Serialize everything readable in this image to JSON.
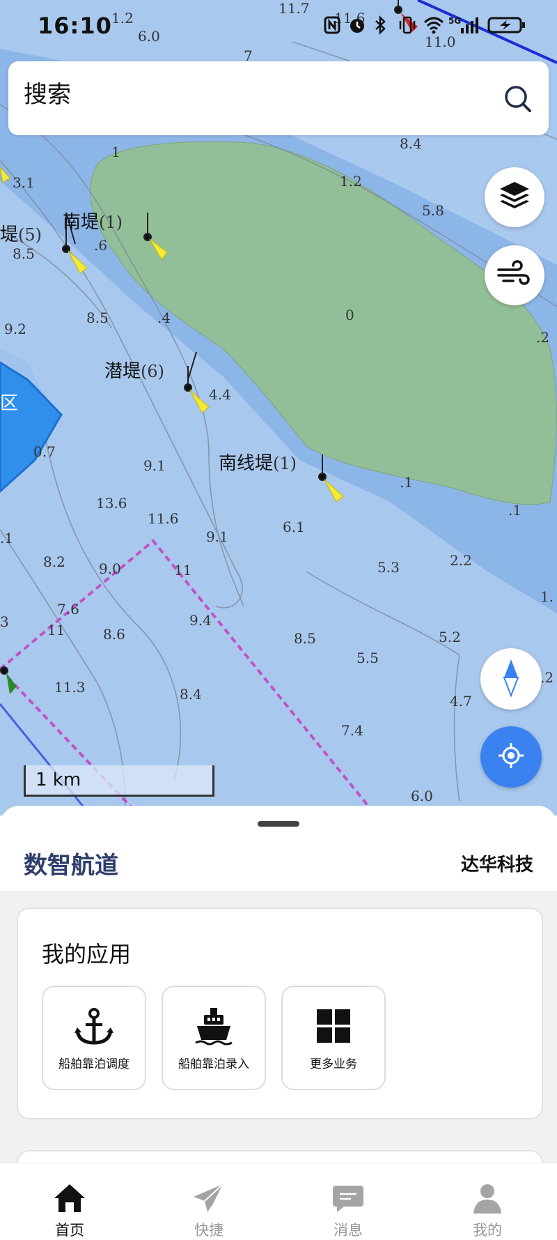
{
  "status_bar": {
    "time": "16:10",
    "network": "5G"
  },
  "search": {
    "placeholder": "搜索",
    "icon": "search-icon"
  },
  "map": {
    "labels": [
      {
        "name": "南堤",
        "num": "(1)"
      },
      {
        "name": "堤",
        "num": "(5)"
      },
      {
        "name": "潜堤",
        "num": "(6)"
      },
      {
        "name": "南线堤",
        "num": "(1)"
      }
    ],
    "zone_label": "区",
    "depths": [
      "11.7",
      "1.2",
      "6.0",
      "7",
      "11.6",
      "11.0",
      "8.4",
      "1",
      "3.1",
      "1.2",
      "5.8",
      "8.5",
      ".6",
      "8.5",
      ".4",
      "0",
      "9.2",
      ".2",
      "4.4",
      "0.7",
      "9.1",
      ".1",
      "13.6",
      "11.6",
      "9.1",
      "6.1",
      ".1",
      ".1",
      "8.2",
      "9.0",
      "11",
      "5.3",
      "2.2",
      "7.6",
      "1.",
      "3",
      "11",
      "8.6",
      "9.4",
      "8.5",
      "5.2",
      "5.5",
      ".2",
      "11.3",
      "8.4",
      "4.7",
      "7.4",
      "6.0"
    ],
    "scale_label": "1 km",
    "buttons": {
      "layers": "layers-icon",
      "wind": "wind-icon",
      "compass": "compass-icon",
      "locate": "locate-icon"
    },
    "colors": {
      "water": "#a9c8ee",
      "deep_water": "#8cb4e6",
      "land": "#93bf98",
      "zone": "#2f8fea",
      "route": "#c053c9"
    }
  },
  "sheet": {
    "title": "数智航道",
    "company": "达华科技",
    "apps_title": "我的应用",
    "apps": [
      {
        "label": "船舶靠泊调度",
        "icon": "anchor-icon"
      },
      {
        "label": "船舶靠泊录入",
        "icon": "ship-icon"
      },
      {
        "label": "更多业务",
        "icon": "grid-icon"
      }
    ]
  },
  "tabs": [
    {
      "label": "首页",
      "icon": "home-icon",
      "active": true
    },
    {
      "label": "快捷",
      "icon": "send-icon",
      "active": false
    },
    {
      "label": "消息",
      "icon": "message-icon",
      "active": false
    },
    {
      "label": "我的",
      "icon": "user-icon",
      "active": false
    }
  ]
}
